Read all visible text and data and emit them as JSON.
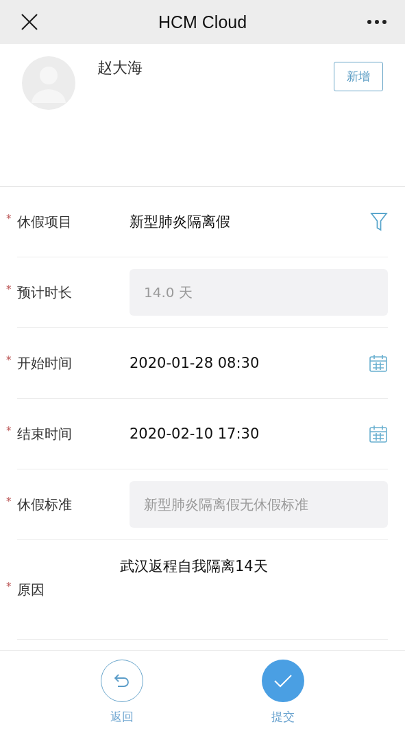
{
  "nav_bar": {
    "title": "HCM Cloud"
  },
  "profile": {
    "name": "赵大海",
    "add_button": "新增"
  },
  "form": {
    "fields": [
      {
        "kind": "select",
        "required_mark": "*",
        "label": "休假项目",
        "value": "新型肺炎隔离假"
      },
      {
        "kind": "readonly",
        "required_mark": "*",
        "label": "预计时长",
        "value": "14.0 天"
      },
      {
        "kind": "date",
        "required_mark": "*",
        "label": "开始时间",
        "value": "2020-01-28 08:30"
      },
      {
        "kind": "date",
        "required_mark": "*",
        "label": "结束时间",
        "value": "2020-02-10 17:30"
      },
      {
        "kind": "readonly",
        "required_mark": "*",
        "label": "休假标准",
        "value": "新型肺炎隔离假无休假标准"
      },
      {
        "kind": "textarea",
        "required_mark": "*",
        "label": "原因",
        "value": "武汉返程自我隔离14天"
      }
    ]
  },
  "actions": [
    {
      "kind": "back",
      "label": "返回"
    },
    {
      "kind": "submit",
      "label": "提交"
    }
  ]
}
